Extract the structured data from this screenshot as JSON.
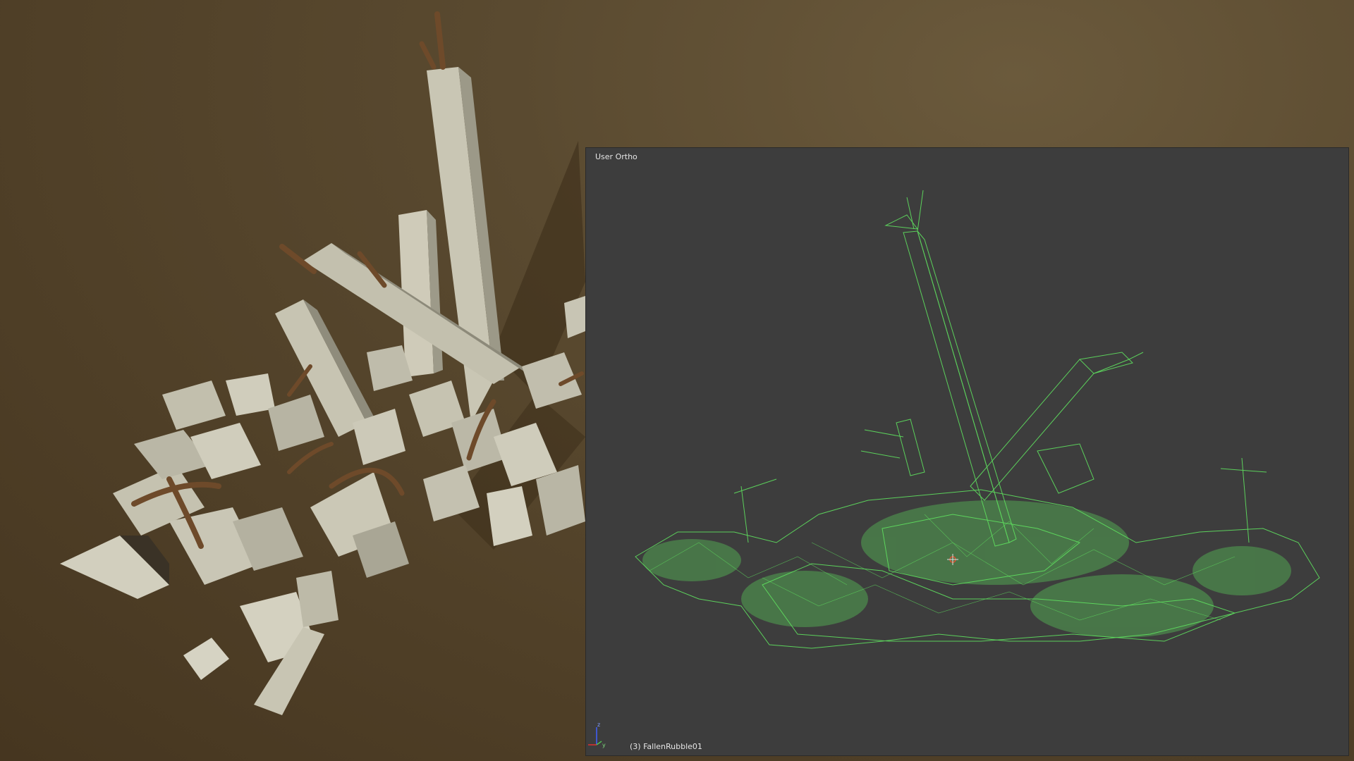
{
  "viewport": {
    "view_name": "User Ortho",
    "object_label": "(3) FallenRubble01"
  },
  "axis_gizmo": {
    "z_label": "z",
    "y_label": "y"
  },
  "colors": {
    "viewport_bg": "#3d3d3d",
    "wireframe": "#5fe05f",
    "stone": "#bdbaa8",
    "rebar": "#6e4a2a",
    "ground": "#5a4a32",
    "axis_x": "#e03030",
    "axis_y": "#4fbf4f",
    "axis_z": "#4060ff"
  }
}
